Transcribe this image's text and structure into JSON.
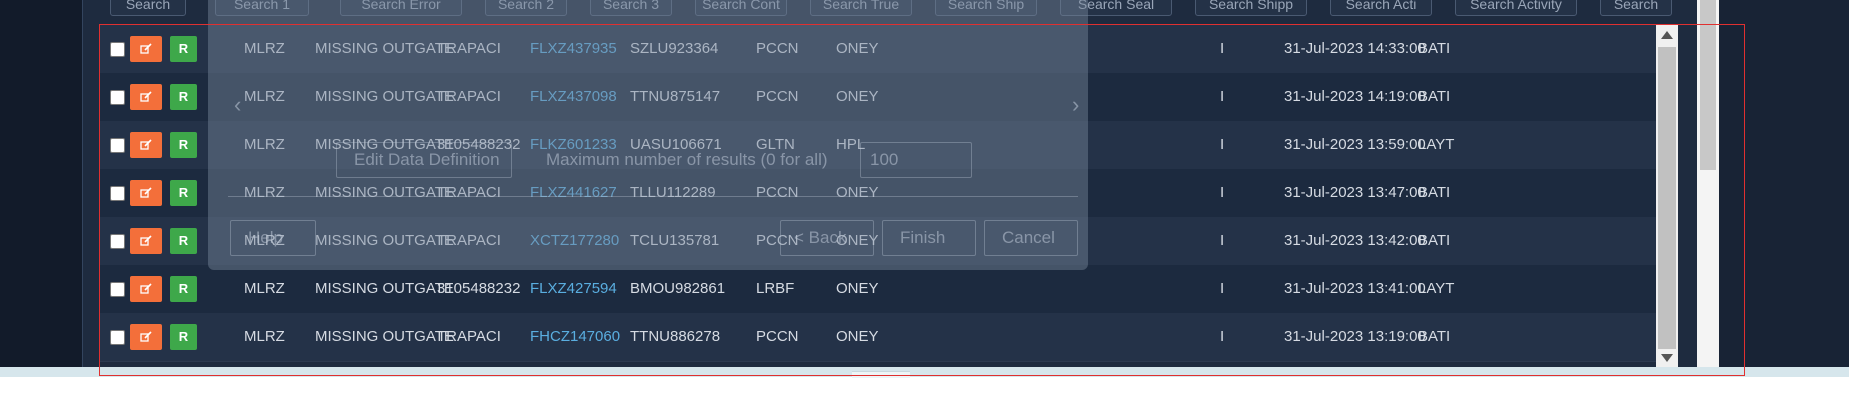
{
  "search_buttons": [
    "Search",
    "Search 1",
    "Search Error",
    "Search 2",
    "Search 3",
    "Search Cont",
    "Search True",
    "Search Ship",
    "Search Seal",
    "Search Shipp",
    "Search Acti",
    "Search Activity",
    "Search"
  ],
  "dialog": {
    "edit_data_definition": "Edit Data Definition",
    "max_results_label": "Maximum number of results (0 for all)",
    "max_results_value": "100",
    "help": "Help",
    "back": "< Back",
    "finish": "Finish",
    "cancel": "Cancel"
  },
  "row_buttons": {
    "r_label": "R"
  },
  "rows": [
    {
      "c1": "MLRZ",
      "c2": "MISSING OUTGATE",
      "c3": "TRAPACI",
      "c4": "FLXZ437935",
      "c5": "SZLU923364",
      "c6": "PCCN",
      "c7": "ONEY",
      "c8": "I",
      "c9": "31-Jul-2023 14:33:00",
      "c10": "BATI"
    },
    {
      "c1": "MLRZ",
      "c2": "MISSING OUTGATE",
      "c3": "TRAPACI",
      "c4": "FLXZ437098",
      "c5": "TTNU875147",
      "c6": "PCCN",
      "c7": "ONEY",
      "c8": "I",
      "c9": "31-Jul-2023 14:19:00",
      "c10": "BATI"
    },
    {
      "c1": "MLRZ",
      "c2": "MISSING OUTGATE",
      "c3": "3105488232",
      "c4": "FLKZ601233",
      "c5": "UASU106671",
      "c6": "GLTN",
      "c7": "HPL",
      "c8": "I",
      "c9": "31-Jul-2023 13:59:00",
      "c10": "LAYT"
    },
    {
      "c1": "MLRZ",
      "c2": "MISSING OUTGATE",
      "c3": "TRAPACI",
      "c4": "FLXZ441627",
      "c5": "TLLU112289",
      "c6": "PCCN",
      "c7": "ONEY",
      "c8": "I",
      "c9": "31-Jul-2023 13:47:00",
      "c10": "BATI"
    },
    {
      "c1": "MLRZ",
      "c2": "MISSING OUTGATE",
      "c3": "TRAPACI",
      "c4": "XCTZ177280",
      "c5": "TCLU135781",
      "c6": "PCCN",
      "c7": "ONEY",
      "c8": "I",
      "c9": "31-Jul-2023 13:42:00",
      "c10": "BATI"
    },
    {
      "c1": "MLRZ",
      "c2": "MISSING OUTGATE",
      "c3": "3105488232",
      "c4": "FLXZ427594",
      "c5": "BMOU982861",
      "c6": "LRBF",
      "c7": "ONEY",
      "c8": "I",
      "c9": "31-Jul-2023 13:41:00",
      "c10": "LAYT"
    },
    {
      "c1": "MLRZ",
      "c2": "MISSING OUTGATE",
      "c3": "TRAPACI",
      "c4": "FHCZ147060",
      "c5": "TTNU886278",
      "c6": "PCCN",
      "c7": "ONEY",
      "c8": "I",
      "c9": "31-Jul-2023 13:19:00",
      "c10": "BATI"
    }
  ]
}
